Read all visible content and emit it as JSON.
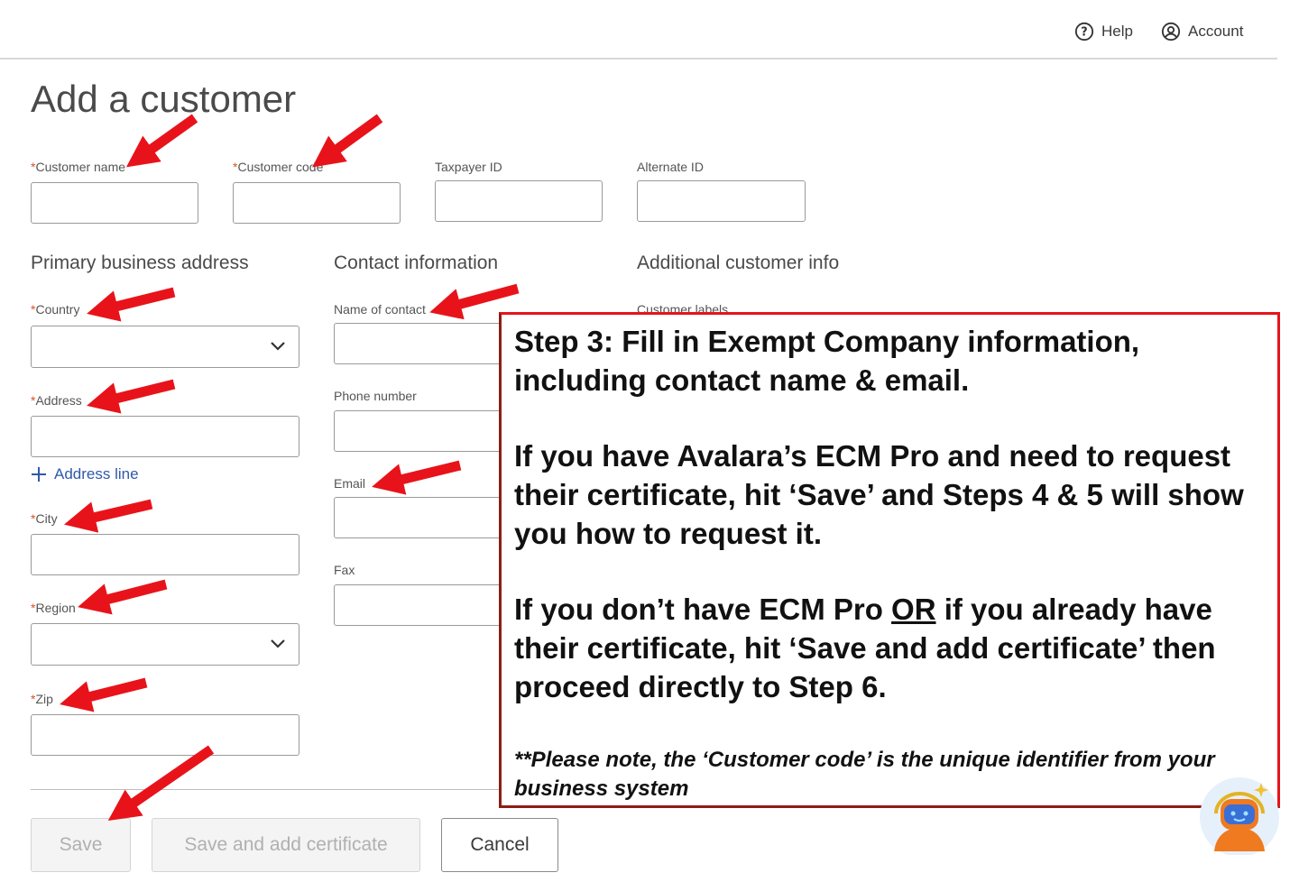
{
  "header": {
    "help_label": "Help",
    "account_label": "Account"
  },
  "page": {
    "title": "Add a customer"
  },
  "fields_top": {
    "customer_name": {
      "label": "Customer name",
      "required": "*",
      "value": ""
    },
    "customer_code": {
      "label": "Customer code",
      "required": "*",
      "value": ""
    },
    "taxpayer_id": {
      "label": "Taxpayer ID",
      "value": ""
    },
    "alternate_id": {
      "label": "Alternate ID",
      "value": ""
    }
  },
  "address": {
    "heading": "Primary business address",
    "country_label": "Country",
    "address_label": "Address",
    "add_line_label": "Address line",
    "city_label": "City",
    "region_label": "Region",
    "zip_label": "Zip",
    "required": "*"
  },
  "contact": {
    "heading": "Contact information",
    "name_label": "Name of contact",
    "phone_label": "Phone number",
    "email_label": "Email",
    "fax_label": "Fax"
  },
  "additional": {
    "heading": "Additional customer info",
    "labels_label": "Customer labels"
  },
  "buttons": {
    "save": "Save",
    "save_add_cert": "Save and add certificate",
    "cancel": "Cancel"
  },
  "callout": {
    "p1": "Step 3: Fill in Exempt Company information, including contact name & email.",
    "p2": "If you have Avalara’s ECM Pro and need to request their certificate, hit ‘Save’ and Steps 4 & 5 will show you how to request it.",
    "p3_a": "If you don’t have ECM Pro ",
    "p3_b": "OR",
    "p3_c": " if you already have their certificate, hit ‘Save and add certificate’ then proceed directly to Step 6.",
    "note": "**Please note, the ‘Customer code’ is the unique identifier from your business system"
  },
  "colors": {
    "arrow": "#e8131a",
    "required": "#d9541e",
    "link": "#2f5aa8",
    "callout_border": "#e8131a"
  }
}
